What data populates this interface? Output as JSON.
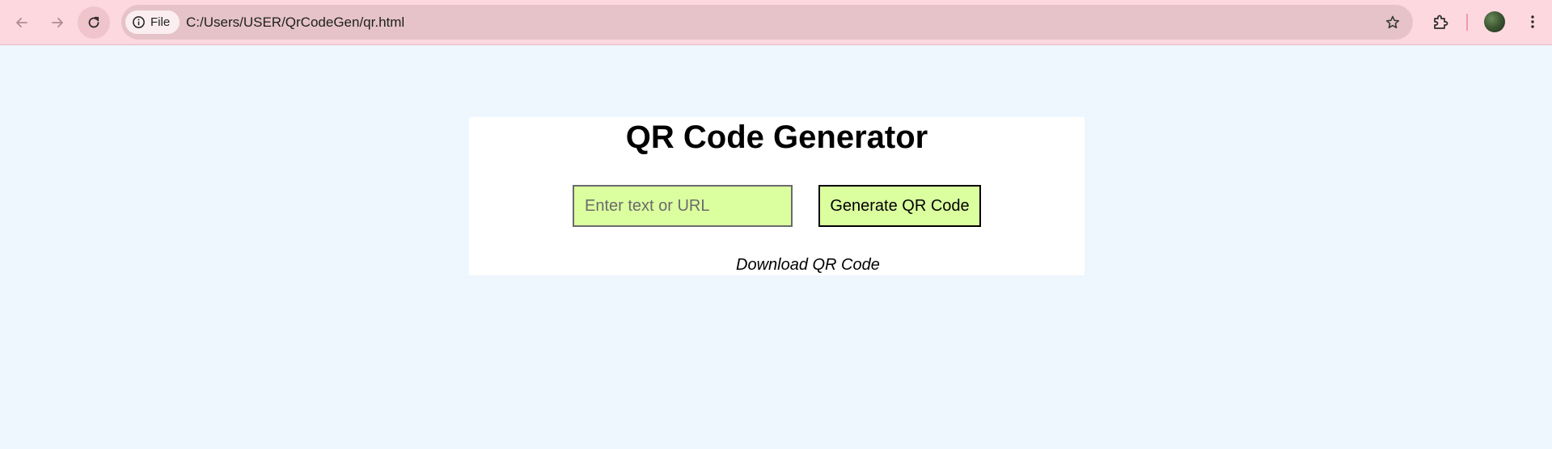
{
  "browser": {
    "site_chip_label": "File",
    "url": "C:/Users/USER/QrCodeGen/qr.html",
    "icons": {
      "back": "arrow-left-icon",
      "forward": "arrow-right-icon",
      "reload": "reload-icon",
      "site_info": "info-icon",
      "bookmark": "star-icon",
      "extensions": "puzzle-icon",
      "profile": "avatar",
      "menu": "kebab-menu-icon"
    },
    "colors": {
      "toolbar_bg": "#fdd8de",
      "omnibox_bg": "#e5c3c8"
    }
  },
  "page": {
    "title": "QR Code Generator",
    "input": {
      "placeholder": "Enter text or URL",
      "value": ""
    },
    "generate_button_label": "Generate QR Code",
    "download_link_label": "Download QR Code",
    "colors": {
      "page_bg": "#eef6fe",
      "card_bg": "#ffffff",
      "control_bg": "#dbff9f"
    }
  }
}
